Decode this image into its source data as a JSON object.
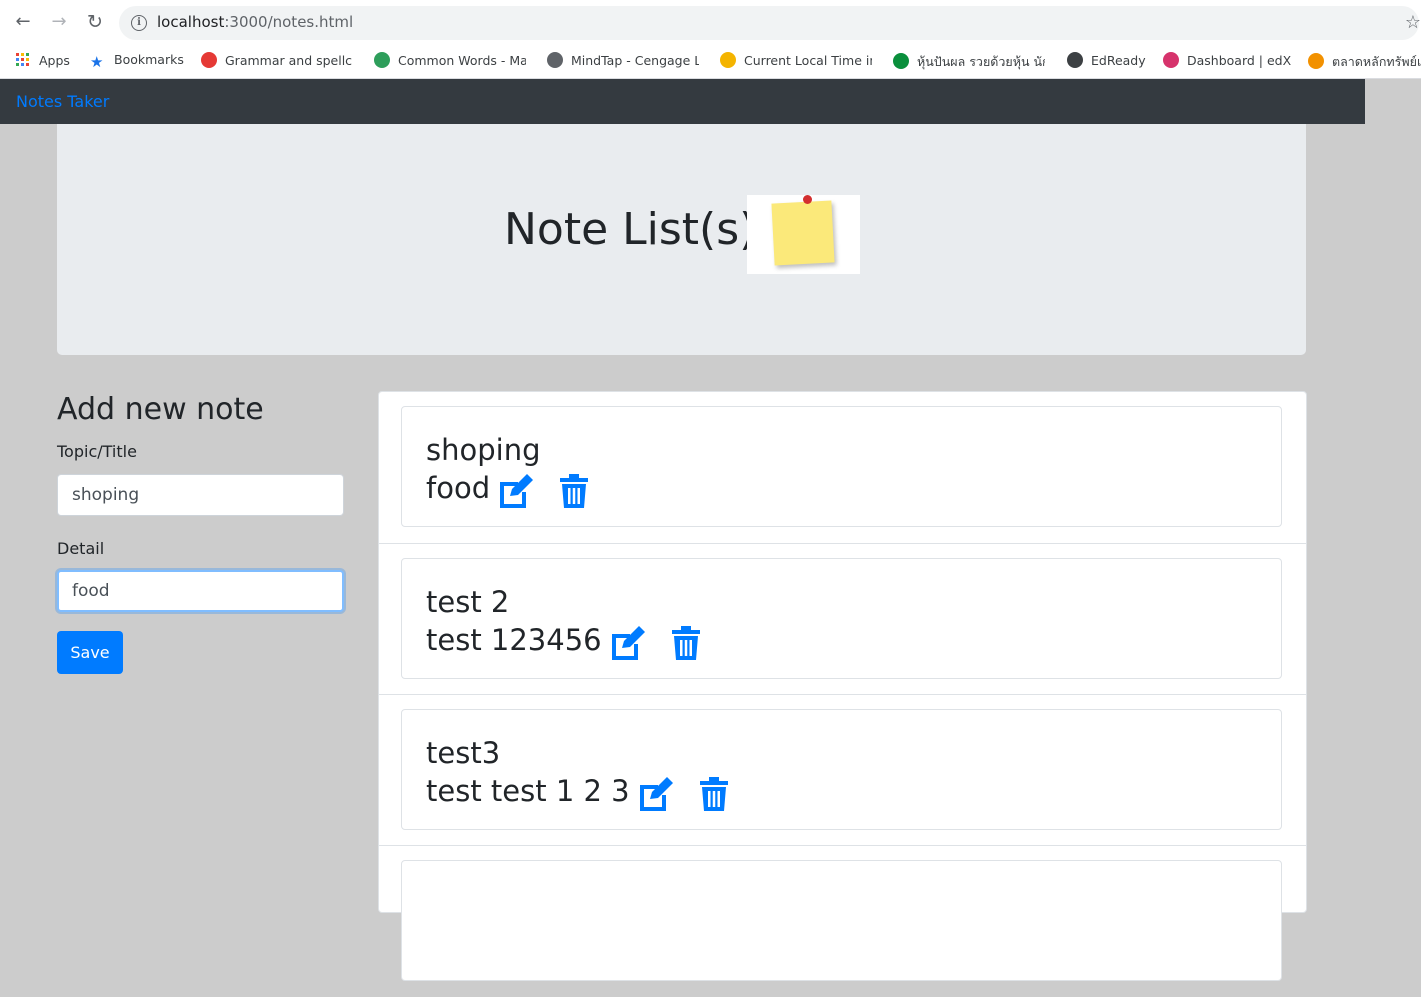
{
  "browser": {
    "url_host": "localhost",
    "url_path": ":3000/notes.html",
    "bookmarks": [
      {
        "label": "Apps",
        "icon": "apps-grid-icon",
        "color": "#ea4335"
      },
      {
        "label": "Bookmarks",
        "icon": "star-icon",
        "color": "#1a73e8"
      },
      {
        "label": "Grammar and spellch",
        "icon": "grammar-icon",
        "color": "#e53935"
      },
      {
        "label": "Common Words - Ma",
        "icon": "common-words-icon",
        "color": "#2e9e5b"
      },
      {
        "label": "MindTap - Cengage L",
        "icon": "mindtap-icon",
        "color": "#5f6368"
      },
      {
        "label": "Current Local Time in",
        "icon": "time-icon",
        "color": "#f4b400"
      },
      {
        "label": "หุ้นปันผล รวยด้วยหุ้น นัก",
        "icon": "stock-icon",
        "color": "#0a8f3c"
      },
      {
        "label": "EdReady",
        "icon": "edready-icon",
        "color": "#3c4043"
      },
      {
        "label": "Dashboard | edX",
        "icon": "edx-icon",
        "color": "#d6336c"
      },
      {
        "label": "ตลาดหลักทรัพย์แ",
        "icon": "set-icon",
        "color": "#f29100"
      }
    ]
  },
  "navbar": {
    "brand": "Notes Taker"
  },
  "jumbotron": {
    "title": "Note List(s)"
  },
  "form": {
    "heading": "Add new note",
    "title_label": "Topic/Title",
    "title_value": "shoping",
    "detail_label": "Detail",
    "detail_value": "food",
    "save_label": "Save"
  },
  "notes": [
    {
      "title": "shoping",
      "detail": "food"
    },
    {
      "title": "test 2",
      "detail": "test 123456"
    },
    {
      "title": "test3",
      "detail": "test test 1 2 3"
    }
  ],
  "colors": {
    "accent": "#007bff",
    "navbar": "#343a40",
    "page_bg": "#cccccc"
  }
}
